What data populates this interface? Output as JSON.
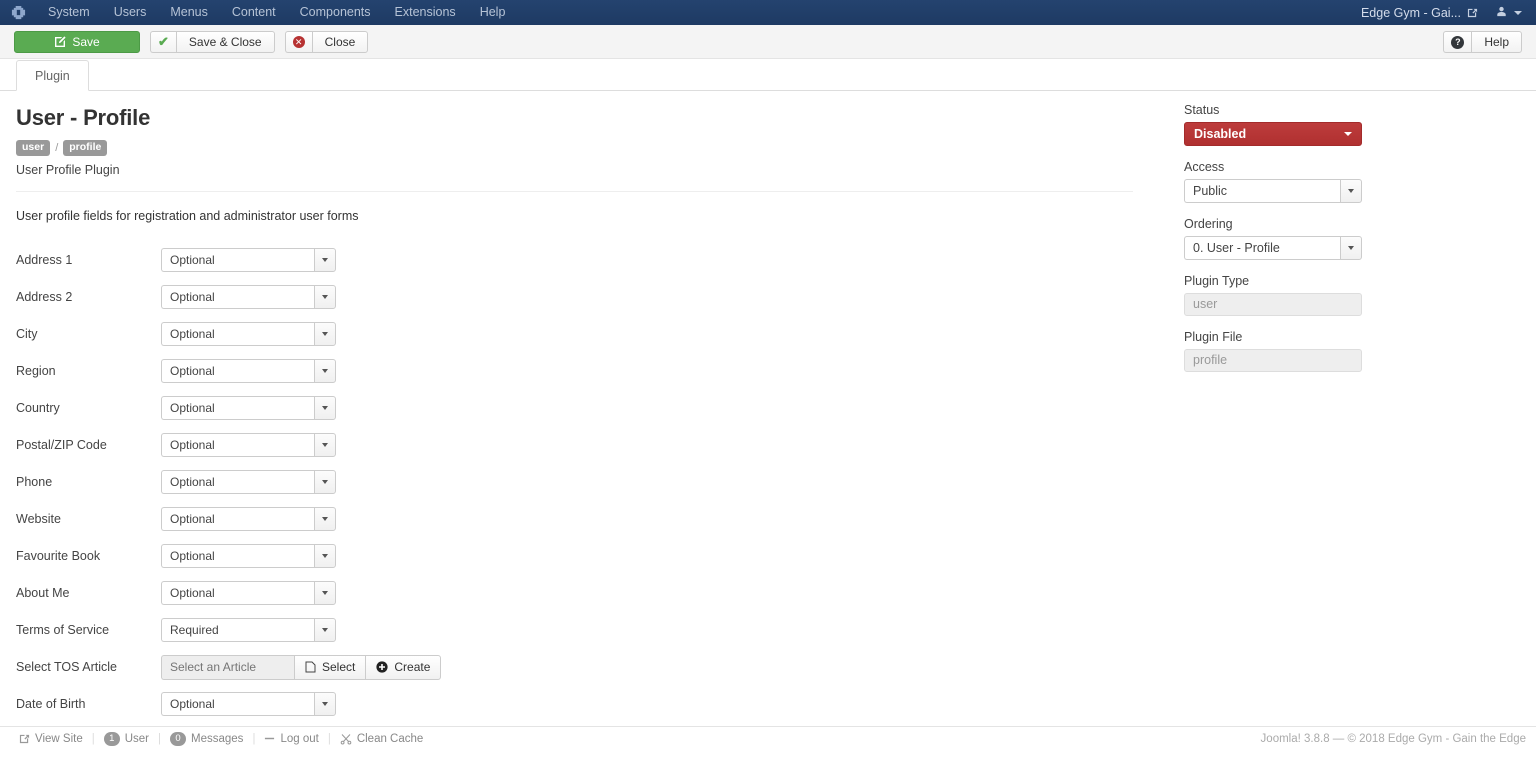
{
  "topnav": {
    "brand_icon": "joomla-logo-icon",
    "items": [
      {
        "label": "System"
      },
      {
        "label": "Users"
      },
      {
        "label": "Menus"
      },
      {
        "label": "Content"
      },
      {
        "label": "Components"
      },
      {
        "label": "Extensions"
      },
      {
        "label": "Help"
      }
    ],
    "site_name": "Edge Gym - Gai...",
    "external_link_icon": "external-link-icon",
    "user_icon": "user-icon"
  },
  "toolbar": {
    "save_label": "Save",
    "save_icon": "edit-square-icon",
    "save_close_label": "Save & Close",
    "save_close_icon": "check-icon",
    "close_label": "Close",
    "close_icon": "cancel-circle-icon",
    "help_label": "Help",
    "help_icon": "question-circle-icon"
  },
  "tabs": [
    {
      "label": "Plugin",
      "active": true
    }
  ],
  "main": {
    "title": "User - Profile",
    "badges": [
      "user",
      "profile"
    ],
    "badge_separator": "/",
    "description": "User Profile Plugin",
    "form_note": "User profile fields for registration and administrator user forms",
    "fields": [
      {
        "label": "Address 1",
        "value": "Optional"
      },
      {
        "label": "Address 2",
        "value": "Optional"
      },
      {
        "label": "City",
        "value": "Optional"
      },
      {
        "label": "Region",
        "value": "Optional"
      },
      {
        "label": "Country",
        "value": "Optional"
      },
      {
        "label": "Postal/ZIP Code",
        "value": "Optional"
      },
      {
        "label": "Phone",
        "value": "Optional"
      },
      {
        "label": "Website",
        "value": "Optional"
      },
      {
        "label": "Favourite Book",
        "value": "Optional"
      },
      {
        "label": "About Me",
        "value": "Optional"
      },
      {
        "label": "Terms of Service",
        "value": "Required"
      }
    ],
    "tos_article": {
      "label": "Select TOS Article",
      "placeholder": "Select an Article",
      "value": "",
      "select_label": "Select",
      "select_icon": "file-icon",
      "create_label": "Create",
      "create_icon": "plus-circle-icon"
    },
    "dob_field": {
      "label": "Date of Birth",
      "value": "Optional"
    }
  },
  "sidebar": {
    "status": {
      "label": "Status",
      "value": "Disabled",
      "color": "#b73333"
    },
    "access": {
      "label": "Access",
      "value": "Public"
    },
    "ordering": {
      "label": "Ordering",
      "value": "0. User - Profile"
    },
    "plugin_type": {
      "label": "Plugin Type",
      "value": "user"
    },
    "plugin_file": {
      "label": "Plugin File",
      "value": "profile"
    }
  },
  "footer": {
    "view_site": {
      "label": "View Site",
      "icon": "external-link-icon"
    },
    "users": {
      "count": "1",
      "label": "User"
    },
    "messages": {
      "count": "0",
      "label": "Messages"
    },
    "logout": {
      "label": "Log out",
      "icon": "minus-icon"
    },
    "clean_cache": {
      "label": "Clean Cache",
      "icon": "scissors-icon"
    },
    "copyright": "Joomla! 3.8.8  —  © 2018 Edge Gym - Gain the Edge"
  }
}
